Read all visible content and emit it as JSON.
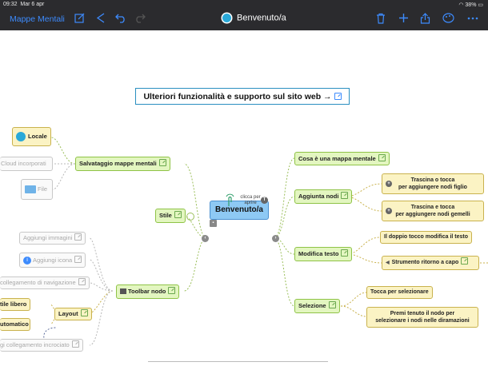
{
  "status_bar": {
    "time": "09:32",
    "date": "Mar 6 apr",
    "battery": "38%"
  },
  "toolbar": {
    "back_label": "Mappe Mentali",
    "title": "Benvenuto/a",
    "icons": [
      "edit-icon",
      "focus-icon",
      "undo-icon",
      "redo-icon",
      "trash-icon",
      "add-icon",
      "share-icon",
      "palette-icon",
      "more-icon"
    ]
  },
  "colors": {
    "toolbar_bg": "#2b2b2e",
    "accent": "#3d8bfd",
    "green_node": "#e3f6c0",
    "yellow_node": "#fbf3c4",
    "center_node": "#8ec9f4"
  },
  "map": {
    "banner": "Ulteriori funzionalità e supporto sul sito web →",
    "center": "Benvenuto/a",
    "center_hint": "clicca per aprire",
    "left": {
      "salvataggio": "Salvataggio mappe mentali",
      "locale": "Locale",
      "cloud": "Cloud incorporati",
      "file": "File",
      "stile": "Stile",
      "toolbar_nodo": "Toolbar nodo",
      "aggiungi_immagini": "Aggiungi immagini",
      "aggiungi_icona": "Aggiungi icona",
      "collegamento_navigazione": "collegamento di navigazione",
      "layout": "Layout",
      "stile_libero": "tile libero",
      "automatico": "utomatico",
      "collegamento_incrociato": "gi collegamento incrociato"
    },
    "right": {
      "cosa_e": "Cosa è una mappa mentale",
      "aggiunta_nodi": "Aggiunta nodi",
      "trascina_figlio": [
        "Trascina o tocca",
        "per aggiungere nodi figlio"
      ],
      "trascina_gemelli": [
        "Trascina e tocca",
        "per aggiungere nodi gemelli"
      ],
      "modifica_testo": "Modifica testo",
      "doppio_tocco": "Il doppio tocco modifica il testo",
      "strumento_ritorno": "Strumento ritorno a capo",
      "selezione": "Selezione",
      "tocca_selezionare": "Tocca per selezionare",
      "premi_tenuto": [
        "Premi tenuto il nodo per",
        "selezionare i nodi nelle diramazioni"
      ]
    }
  }
}
